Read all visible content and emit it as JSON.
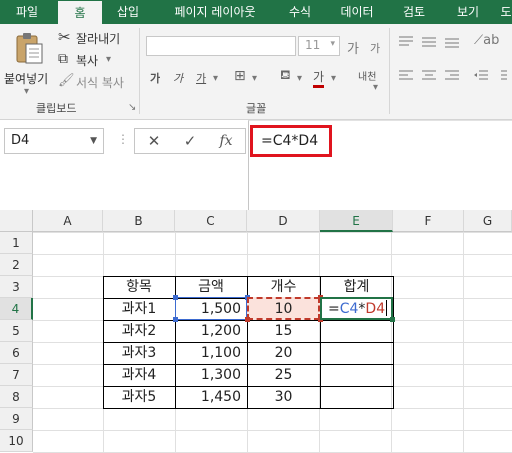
{
  "ribbon": {
    "tabs": [
      "파일",
      "홈",
      "삽입",
      "페이지 레이아웃",
      "수식",
      "데이터",
      "검토",
      "보기",
      "도"
    ],
    "clipboard": {
      "paste": "붙여넣기",
      "cut": "잘라내기",
      "copy": "복사",
      "format_painter": "서식 복사",
      "group_label": "클립보드"
    },
    "font": {
      "size": "11",
      "increase": "가",
      "decrease": "가",
      "bold": "가",
      "italic": "가",
      "underline": "가",
      "font_color": "가",
      "phonetic": "내천",
      "group_label": "글꼴"
    }
  },
  "formula_bar": {
    "name_box": "D4",
    "cancel": "✕",
    "enter": "✓",
    "fx": "fx",
    "formula": "=C4*D4"
  },
  "sheet": {
    "columns": [
      "A",
      "B",
      "C",
      "D",
      "E",
      "F",
      "G"
    ],
    "rows": [
      "1",
      "2",
      "3",
      "4",
      "5",
      "6",
      "7",
      "8",
      "9",
      "10"
    ],
    "table_header": [
      "항목",
      "금액",
      "개수",
      "합계"
    ],
    "table_rows": [
      {
        "item": "과자1",
        "amount": "1,500",
        "count": "10"
      },
      {
        "item": "과자2",
        "amount": "1,200",
        "count": "15"
      },
      {
        "item": "과자3",
        "amount": "1,100",
        "count": "20"
      },
      {
        "item": "과자4",
        "amount": "1,300",
        "count": "25"
      },
      {
        "item": "과자5",
        "amount": "1,450",
        "count": "30"
      }
    ],
    "editing_cell": {
      "prefix": "=",
      "ref1": "C4",
      "op": "*",
      "ref2": "D4"
    },
    "active_column": "E",
    "active_row": "4"
  },
  "colors": {
    "accent": "#217346",
    "ref_blue": "#3d6bd0",
    "ref_red": "#c0392b",
    "highlight_box": "#e0141e"
  }
}
